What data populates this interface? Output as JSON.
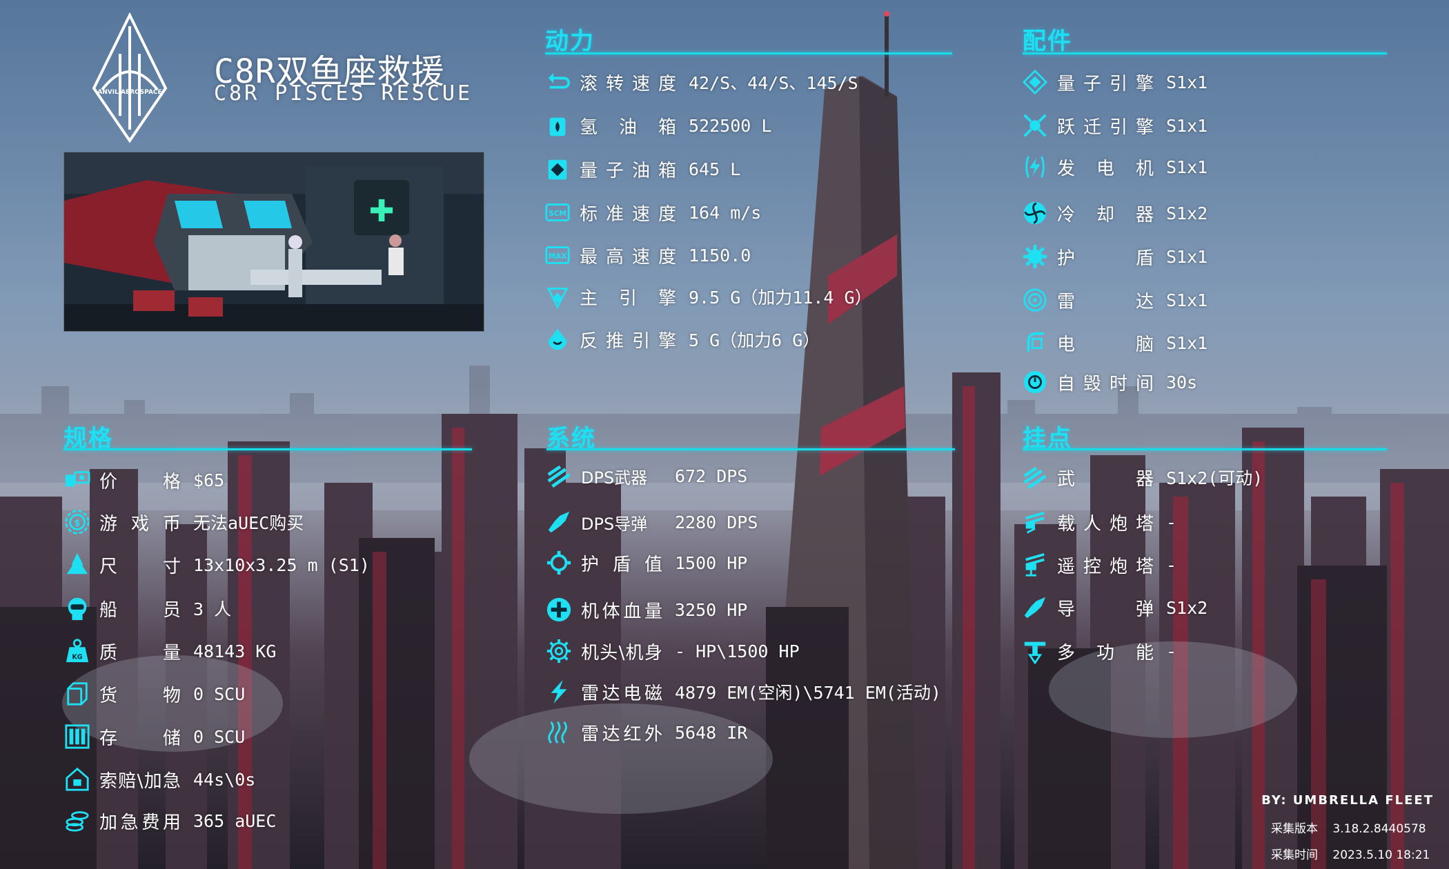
{
  "header": {
    "logo_text": "ANVIL AEROSPACE",
    "title_cn": "C8R双鱼座救援",
    "title_en": "C8R PISCES RESCUE"
  },
  "theme": {
    "accent": "#1fe0f2"
  },
  "sections": {
    "power": "动力",
    "parts": "配件",
    "specs": "规格",
    "system": "系统",
    "hardpoints": "挂点"
  },
  "power": [
    {
      "icon": "roll-icon",
      "label": "滚转速度",
      "value": "42/S、44/S、145/S"
    },
    {
      "icon": "hydrogen-tank-icon",
      "label": "氢 油 箱",
      "value": "522500 L"
    },
    {
      "icon": "quantum-tank-icon",
      "label": "量子油箱",
      "value": "645 L"
    },
    {
      "icon": "scm-icon",
      "label": "标准速度",
      "value": "164 m/s"
    },
    {
      "icon": "max-speed-icon",
      "label": "最高速度",
      "value": "1150.0"
    },
    {
      "icon": "main-thruster-icon",
      "label": "主 引 擎",
      "value": "9.5 G（加力11.4 G）"
    },
    {
      "icon": "retro-thruster-icon",
      "label": "反推引擎",
      "value": "5 G（加力6 G）"
    }
  ],
  "parts": [
    {
      "icon": "quantum-drive-icon",
      "label": "量子引擎",
      "value": "S1x1"
    },
    {
      "icon": "jump-drive-icon",
      "label": "跃迁引擎",
      "value": "S1x1"
    },
    {
      "icon": "power-plant-icon",
      "label": "发 电 机",
      "value": "S1x1"
    },
    {
      "icon": "cooler-icon",
      "label": "冷 却 器",
      "value": "S1x2"
    },
    {
      "icon": "shield-icon",
      "label": "护  盾",
      "value": "S1x1"
    },
    {
      "icon": "radar-icon",
      "label": "雷  达",
      "value": "S1x1"
    },
    {
      "icon": "computer-icon",
      "label": "电  脑",
      "value": "S1x1"
    },
    {
      "icon": "self-destruct-icon",
      "label": "自毁时间",
      "value": "30s"
    }
  ],
  "specs": [
    {
      "icon": "price-icon",
      "label": "价  格",
      "value": "$65"
    },
    {
      "icon": "coin-icon",
      "label": "游 戏 币",
      "value": "无法aUEC购买"
    },
    {
      "icon": "size-icon",
      "label": "尺  寸",
      "value": "13x10x3.25 m (S1)"
    },
    {
      "icon": "crew-icon",
      "label": "船  员",
      "value": "3 人"
    },
    {
      "icon": "mass-icon",
      "label": "质  量",
      "value": "48143 KG"
    },
    {
      "icon": "cargo-icon",
      "label": "货  物",
      "value": "0 SCU"
    },
    {
      "icon": "storage-icon",
      "label": "存  储",
      "value": "0 SCU"
    },
    {
      "icon": "claim-icon",
      "label": "索赔\\加急",
      "value": "44s\\0s"
    },
    {
      "icon": "expedite-icon",
      "label": "加急费用",
      "value": "365 aUEC"
    }
  ],
  "system": [
    {
      "icon": "weapon-dps-icon",
      "label": "DPS武器",
      "value": "672 DPS"
    },
    {
      "icon": "missile-dps-icon",
      "label": "DPS导弹",
      "value": "2280 DPS"
    },
    {
      "icon": "shield-hp-icon",
      "label": "护 盾 值",
      "value": "1500 HP"
    },
    {
      "icon": "hull-hp-icon",
      "label": "机体血量",
      "value": "3250 HP"
    },
    {
      "icon": "gear-icon",
      "label": "机头\\机身",
      "value": "- HP\\1500 HP"
    },
    {
      "icon": "em-icon",
      "label": "雷达电磁",
      "value": "4879 EM(空闲)\\5741 EM(活动)"
    },
    {
      "icon": "ir-icon",
      "label": "雷达红外",
      "value": "5648 IR"
    }
  ],
  "hardpoints": [
    {
      "icon": "weapon-icon",
      "label": "武  器",
      "value": "S1x2(可动)"
    },
    {
      "icon": "manned-turret-icon",
      "label": "载人炮塔",
      "value": "-"
    },
    {
      "icon": "remote-turret-icon",
      "label": "遥控炮塔",
      "value": "-"
    },
    {
      "icon": "missile-icon",
      "label": "导  弹",
      "value": "S1x2"
    },
    {
      "icon": "multi-function-icon",
      "label": "多 功 能",
      "value": "-"
    }
  ],
  "footer": {
    "credit": "BY: UMBRELLA FLEET",
    "version_label": "采集版本",
    "version_value": "3.18.2.8440578",
    "time_label": "采集时间",
    "time_value": "2023.5.10 18:21"
  }
}
